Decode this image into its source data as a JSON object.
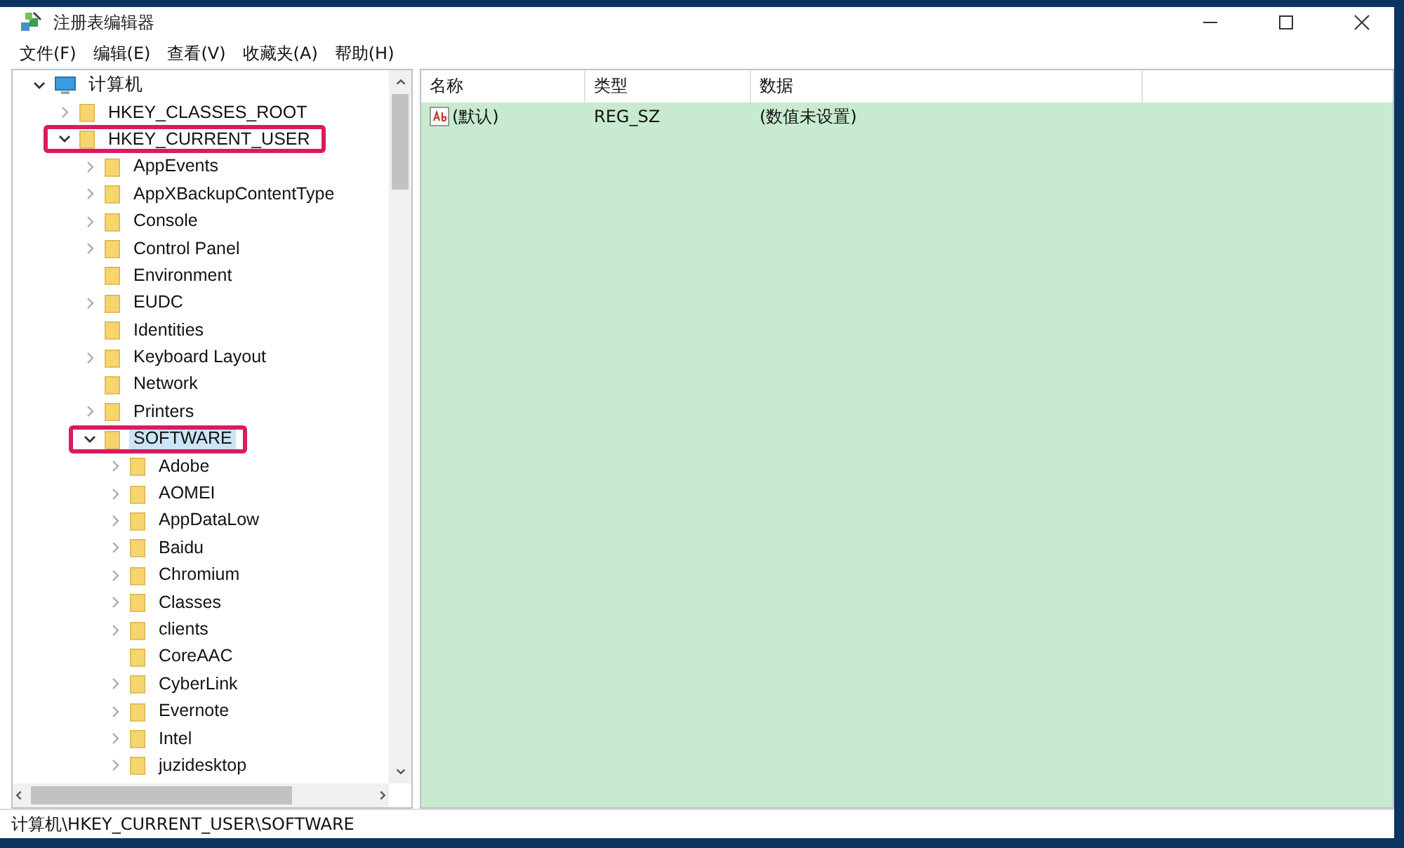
{
  "window": {
    "title": "注册表编辑器"
  },
  "menu": [
    "文件(F)",
    "编辑(E)",
    "查看(V)",
    "收藏夹(A)",
    "帮助(H)"
  ],
  "tree": [
    {
      "label": "计算机",
      "kind": "computer",
      "expandable": true,
      "expanded": true,
      "selected": false,
      "highlighted": false,
      "children": [
        {
          "label": "HKEY_CLASSES_ROOT",
          "expandable": true,
          "expanded": false,
          "selected": false,
          "highlighted": false
        },
        {
          "label": "HKEY_CURRENT_USER",
          "expandable": true,
          "expanded": true,
          "selected": false,
          "highlighted": true,
          "children": [
            {
              "label": "AppEvents",
              "expandable": true,
              "expanded": false,
              "selected": false,
              "highlighted": false
            },
            {
              "label": "AppXBackupContentType",
              "expandable": true,
              "expanded": false,
              "selected": false,
              "highlighted": false
            },
            {
              "label": "Console",
              "expandable": true,
              "expanded": false,
              "selected": false,
              "highlighted": false
            },
            {
              "label": "Control Panel",
              "expandable": true,
              "expanded": false,
              "selected": false,
              "highlighted": false
            },
            {
              "label": "Environment",
              "expandable": false,
              "selected": false,
              "highlighted": false
            },
            {
              "label": "EUDC",
              "expandable": true,
              "expanded": false,
              "selected": false,
              "highlighted": false
            },
            {
              "label": "Identities",
              "expandable": false,
              "selected": false,
              "highlighted": false
            },
            {
              "label": "Keyboard Layout",
              "expandable": true,
              "expanded": false,
              "selected": false,
              "highlighted": false
            },
            {
              "label": "Network",
              "expandable": false,
              "selected": false,
              "highlighted": false
            },
            {
              "label": "Printers",
              "expandable": true,
              "expanded": false,
              "selected": false,
              "highlighted": false
            },
            {
              "label": "SOFTWARE",
              "expandable": true,
              "expanded": true,
              "selected": true,
              "highlighted": true,
              "children": [
                {
                  "label": "Adobe",
                  "expandable": true,
                  "expanded": false,
                  "selected": false,
                  "highlighted": false
                },
                {
                  "label": "AOMEI",
                  "expandable": true,
                  "expanded": false,
                  "selected": false,
                  "highlighted": false
                },
                {
                  "label": "AppDataLow",
                  "expandable": true,
                  "expanded": false,
                  "selected": false,
                  "highlighted": false
                },
                {
                  "label": "Baidu",
                  "expandable": true,
                  "expanded": false,
                  "selected": false,
                  "highlighted": false
                },
                {
                  "label": "Chromium",
                  "expandable": true,
                  "expanded": false,
                  "selected": false,
                  "highlighted": false
                },
                {
                  "label": "Classes",
                  "expandable": true,
                  "expanded": false,
                  "selected": false,
                  "highlighted": false
                },
                {
                  "label": "clients",
                  "expandable": true,
                  "expanded": false,
                  "selected": false,
                  "highlighted": false
                },
                {
                  "label": "CoreAAC",
                  "expandable": false,
                  "selected": false,
                  "highlighted": false
                },
                {
                  "label": "CyberLink",
                  "expandable": true,
                  "expanded": false,
                  "selected": false,
                  "highlighted": false
                },
                {
                  "label": "Evernote",
                  "expandable": true,
                  "expanded": false,
                  "selected": false,
                  "highlighted": false
                },
                {
                  "label": "Intel",
                  "expandable": true,
                  "expanded": false,
                  "selected": false,
                  "highlighted": false
                },
                {
                  "label": "juzidesktop",
                  "expandable": true,
                  "expanded": false,
                  "selected": false,
                  "highlighted": false
                }
              ]
            }
          ]
        }
      ]
    }
  ],
  "table": {
    "columns": [
      "名称",
      "类型",
      "数据"
    ],
    "rows": [
      {
        "name": "(默认)",
        "type": "REG_SZ",
        "data": "(数值未设置)",
        "kind": "string"
      }
    ]
  },
  "status_bar": "计算机\\HKEY_CURRENT_USER\\SOFTWARE"
}
